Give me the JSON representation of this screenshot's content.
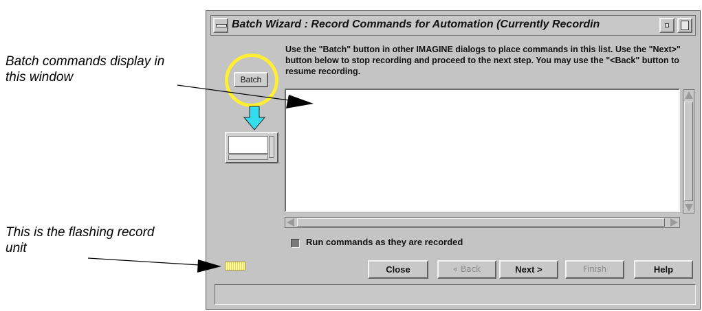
{
  "annotations": {
    "batch_window": "Batch commands display in this window",
    "record_unit": "This is the flashing record unit"
  },
  "window": {
    "title": "Batch Wizard : Record Commands for Automation (Currently Recordin"
  },
  "illustration": {
    "batch_label": "Batch",
    "arrow_color": "#33ddee",
    "highlight_color": "#ffee33"
  },
  "instructions": "Use the \"Batch\" button in other IMAGINE dialogs to place commands in this list. Use the \"Next>\" button below to stop recording and proceed to the next step. You may use the \"<Back\" button to resume recording.",
  "commands_list": [],
  "options": {
    "run_commands_label": "Run commands as they are recorded",
    "run_commands_checked": true
  },
  "buttons": {
    "close": "Close",
    "back": "« Back",
    "next": "Next >",
    "finish": "Finish",
    "help": "Help"
  },
  "status": ""
}
